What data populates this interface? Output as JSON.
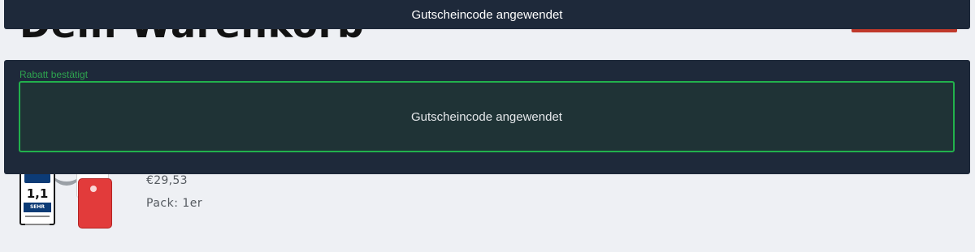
{
  "cart": {
    "title": "Dein Warenkorb",
    "item": {
      "thumbnail": {
        "grade": "1,1",
        "rating": "SEHR GUT"
      },
      "price": "€29,53",
      "variant": "Pack: 1er"
    }
  },
  "toast": {
    "message": "Gutscheincode angewendet"
  },
  "discount": {
    "label": "Rabatt bestätigt",
    "message": "Gutscheincode angewendet"
  },
  "colors": {
    "overlay_bg": "#1e293a",
    "success": "#22b14c",
    "page_bg": "#eef0f4"
  }
}
